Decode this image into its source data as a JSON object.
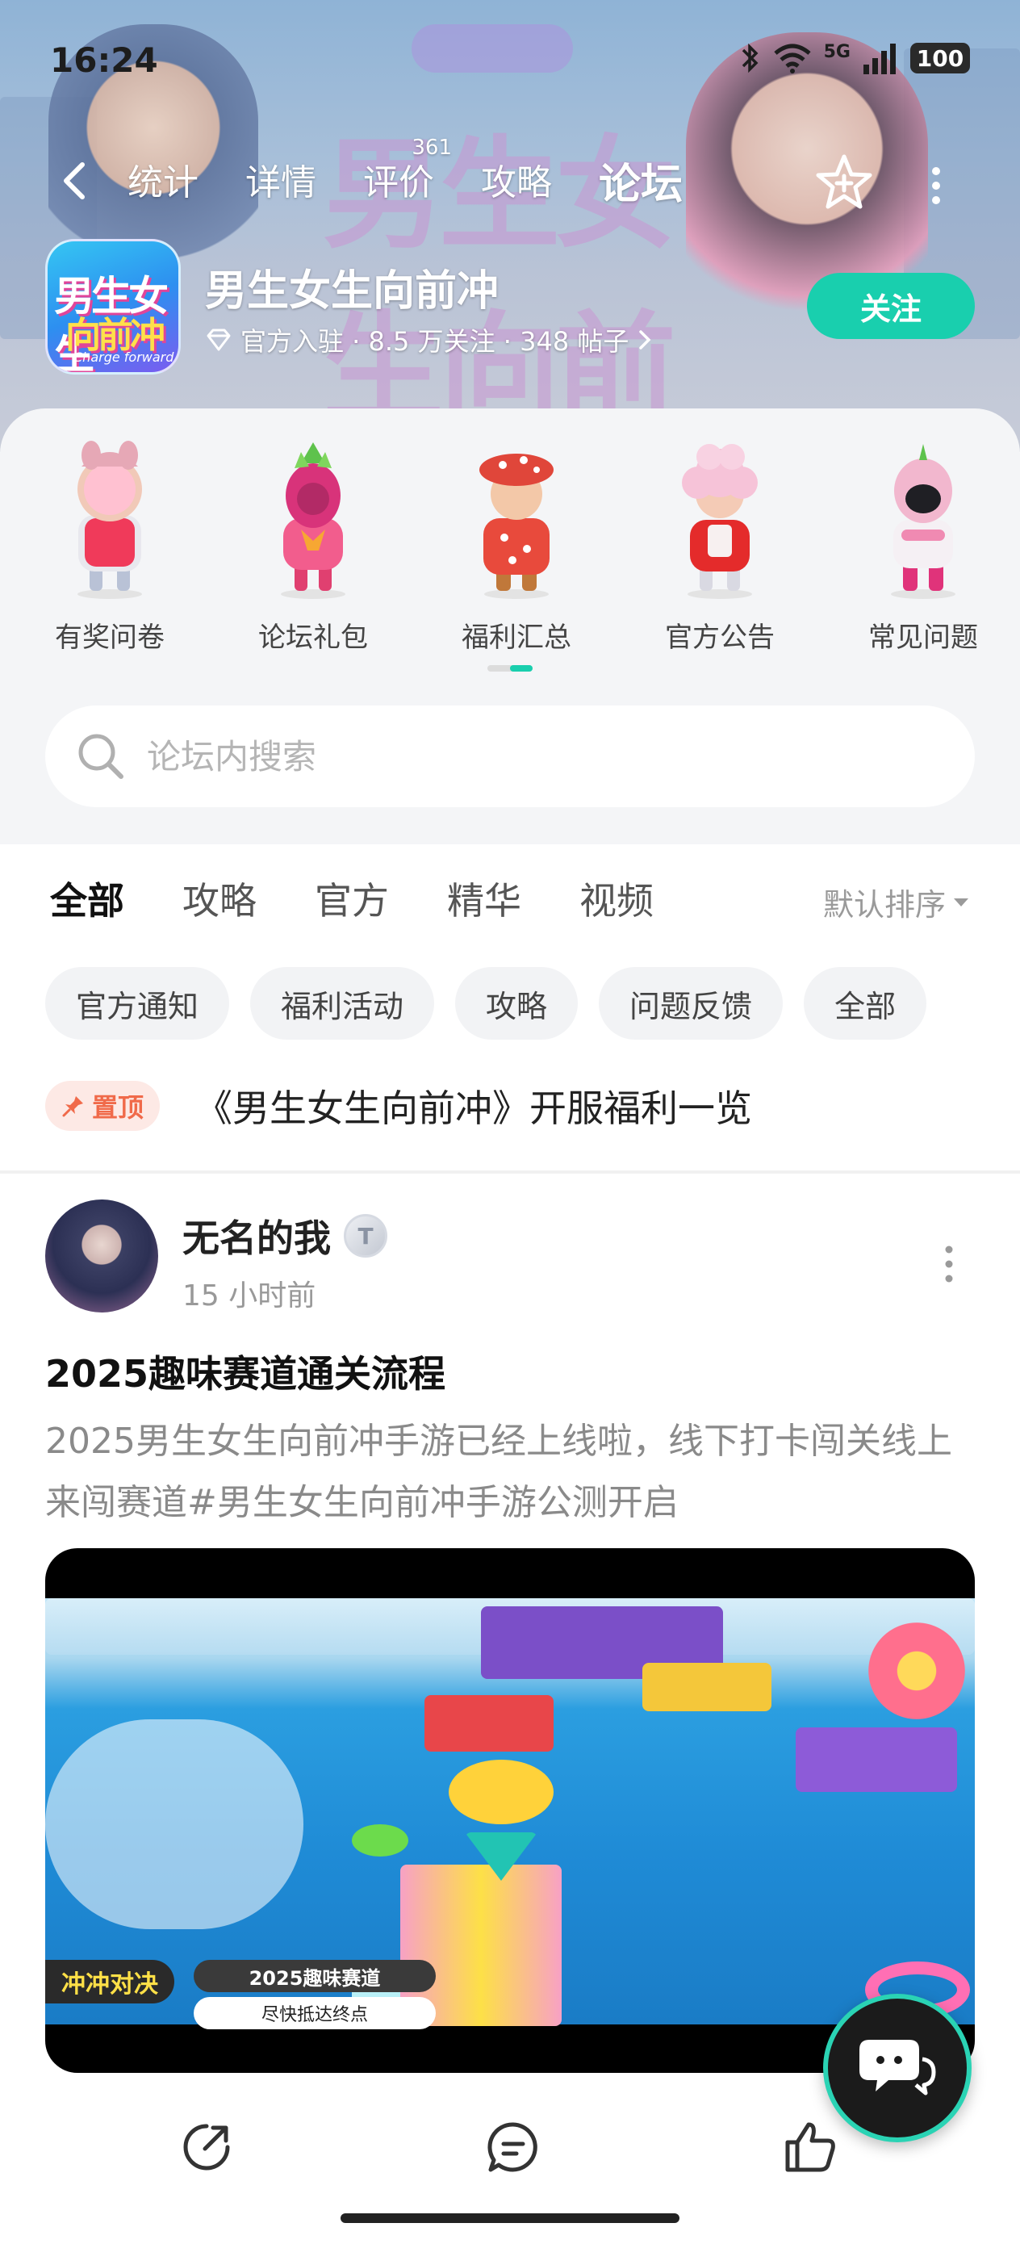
{
  "status_bar": {
    "time": "16:24",
    "network": "5G",
    "battery": "100"
  },
  "nav": {
    "tabs": [
      {
        "label": "统计",
        "active": false
      },
      {
        "label": "详情",
        "active": false
      },
      {
        "label": "评价",
        "active": false,
        "badge": "361"
      },
      {
        "label": "攻略",
        "active": false
      },
      {
        "label": "论坛",
        "active": true
      }
    ]
  },
  "game": {
    "name": "男生女生向前冲",
    "meta": "官方入驻 · 8.5 万关注 · 348 帖子",
    "icon_line1": "男生女生",
    "icon_line2": "向前冲",
    "icon_line3": "Charge forward",
    "follow_label": "关注",
    "banner_title": "男生女生向前冲"
  },
  "quick_entries": [
    {
      "label": "有奖问卷",
      "icon": "survey-mascot"
    },
    {
      "label": "论坛礼包",
      "icon": "gift-mascot"
    },
    {
      "label": "福利汇总",
      "icon": "welfare-mascot"
    },
    {
      "label": "官方公告",
      "icon": "announcement-mascot"
    },
    {
      "label": "常见问题",
      "icon": "faq-mascot"
    }
  ],
  "search": {
    "placeholder": "论坛内搜索"
  },
  "forum_tabs": [
    {
      "label": "全部",
      "active": true
    },
    {
      "label": "攻略",
      "active": false
    },
    {
      "label": "官方",
      "active": false
    },
    {
      "label": "精华",
      "active": false
    },
    {
      "label": "视频",
      "active": false
    }
  ],
  "sort_label": "默认排序",
  "chips": [
    "官方通知",
    "福利活动",
    "攻略",
    "问题反馈",
    "全部"
  ],
  "pinned": {
    "badge": "置顶",
    "title": "《男生女生向前冲》开服福利一览"
  },
  "post": {
    "author": "无名的我",
    "level": "T",
    "time": "15 小时前",
    "title": "2025趣味赛道通关流程",
    "body": "2025男生女生向前冲手游已经上线啦，线下打卡闯关线上来闯赛道#男生女生向前冲手游公测开启",
    "video": {
      "badge": "冲冲对决",
      "caption": "2025趣味赛道",
      "subcaption": "尽快抵达终点"
    }
  },
  "colors": {
    "accent": "#19cfae",
    "pin": "#f06a4a"
  }
}
